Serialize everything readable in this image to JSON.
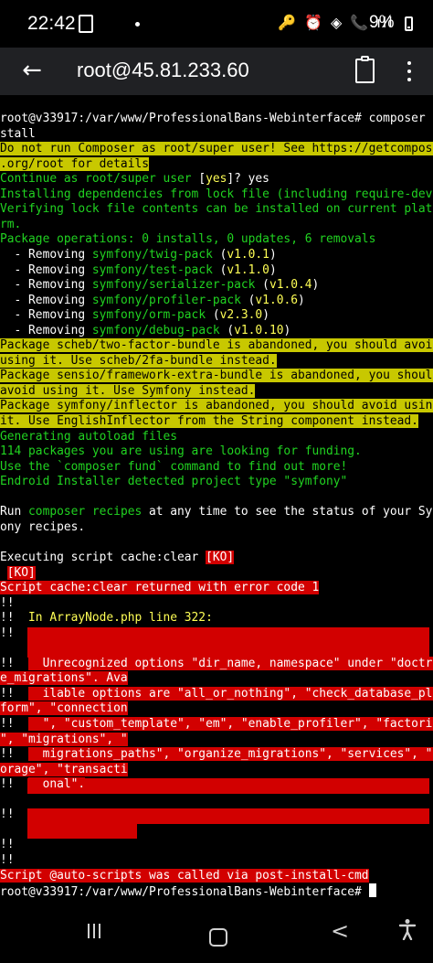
{
  "status_bar": {
    "time": "22:42",
    "dot": "•",
    "indicators": "🔑 ⏰ ◈ 📞.ıll",
    "battery": "9%"
  },
  "header": {
    "back_icon": "←",
    "title": "root@45.81.233.60",
    "clipboard_icon": "clipboard-icon",
    "menu_icon": "more-vert-icon"
  },
  "terminal": {
    "lines": [
      [
        {
          "t": "root@v33917:/var/www/ProfessionalBans-Webinterface# composer in",
          "c": "w"
        }
      ],
      [
        {
          "t": "stall",
          "c": "w"
        }
      ],
      [
        {
          "t": "Do not run Composer as root/super user! See https://getcomposer",
          "c": "hl"
        }
      ],
      [
        {
          "t": ".org/root for details",
          "c": "hl"
        }
      ],
      [
        {
          "t": "Continue as root/super user ",
          "c": "g"
        },
        {
          "t": "[",
          "c": "w"
        },
        {
          "t": "yes",
          "c": "y"
        },
        {
          "t": "]? yes",
          "c": "w"
        }
      ],
      [
        {
          "t": "Installing dependencies from lock file (including require-dev)",
          "c": "g"
        }
      ],
      [
        {
          "t": "Verifying lock file contents can be installed on current platfo",
          "c": "g"
        }
      ],
      [
        {
          "t": "rm.",
          "c": "g"
        }
      ],
      [
        {
          "t": "Package operations: 0 installs, 0 updates, 6 removals",
          "c": "g"
        }
      ],
      [
        {
          "t": "  - Removing ",
          "c": "w"
        },
        {
          "t": "symfony/twig-pack",
          "c": "g"
        },
        {
          "t": " (",
          "c": "w"
        },
        {
          "t": "v1.0.1",
          "c": "y"
        },
        {
          "t": ")",
          "c": "w"
        }
      ],
      [
        {
          "t": "  - Removing ",
          "c": "w"
        },
        {
          "t": "symfony/test-pack",
          "c": "g"
        },
        {
          "t": " (",
          "c": "w"
        },
        {
          "t": "v1.1.0",
          "c": "y"
        },
        {
          "t": ")",
          "c": "w"
        }
      ],
      [
        {
          "t": "  - Removing ",
          "c": "w"
        },
        {
          "t": "symfony/serializer-pack",
          "c": "g"
        },
        {
          "t": " (",
          "c": "w"
        },
        {
          "t": "v1.0.4",
          "c": "y"
        },
        {
          "t": ")",
          "c": "w"
        }
      ],
      [
        {
          "t": "  - Removing ",
          "c": "w"
        },
        {
          "t": "symfony/profiler-pack",
          "c": "g"
        },
        {
          "t": " (",
          "c": "w"
        },
        {
          "t": "v1.0.6",
          "c": "y"
        },
        {
          "t": ")",
          "c": "w"
        }
      ],
      [
        {
          "t": "  - Removing ",
          "c": "w"
        },
        {
          "t": "symfony/orm-pack",
          "c": "g"
        },
        {
          "t": " (",
          "c": "w"
        },
        {
          "t": "v2.3.0",
          "c": "y"
        },
        {
          "t": ")",
          "c": "w"
        }
      ],
      [
        {
          "t": "  - Removing ",
          "c": "w"
        },
        {
          "t": "symfony/debug-pack",
          "c": "g"
        },
        {
          "t": " (",
          "c": "w"
        },
        {
          "t": "v1.0.10",
          "c": "y"
        },
        {
          "t": ")",
          "c": "w"
        }
      ],
      [
        {
          "t": "Package scheb/two-factor-bundle is abandoned, you should avoid ",
          "c": "hl"
        }
      ],
      [
        {
          "t": "using it. Use scheb/2fa-bundle instead.",
          "c": "hl"
        }
      ],
      [
        {
          "t": "Package sensio/framework-extra-bundle is abandoned, you should ",
          "c": "hl"
        }
      ],
      [
        {
          "t": "avoid using it. Use Symfony instead.",
          "c": "hl"
        }
      ],
      [
        {
          "t": "Package symfony/inflector is abandoned, you should avoid using ",
          "c": "hl"
        }
      ],
      [
        {
          "t": "it. Use EnglishInflector from the String component instead.",
          "c": "hl"
        }
      ],
      [
        {
          "t": "Generating autoload files",
          "c": "g"
        }
      ],
      [
        {
          "t": "114 packages you are using are looking for funding.",
          "c": "g"
        }
      ],
      [
        {
          "t": "Use the `composer fund` command to find out more!",
          "c": "g"
        }
      ],
      [
        {
          "t": "Endroid Installer detected project type \"symfony\"",
          "c": "g"
        }
      ],
      [
        {
          "t": "",
          "c": "w"
        }
      ],
      [
        {
          "t": "Run ",
          "c": "w"
        },
        {
          "t": "composer recipes",
          "c": "g"
        },
        {
          "t": " at any time to see the status of your Symf",
          "c": "w"
        }
      ],
      [
        {
          "t": "ony recipes.",
          "c": "w"
        }
      ],
      [
        {
          "t": "",
          "c": "w"
        }
      ],
      [
        {
          "t": "Executing script cache:clear ",
          "c": "w"
        },
        {
          "t": "[KO]",
          "c": "red"
        }
      ],
      [
        {
          "t": " ",
          "c": "w"
        },
        {
          "t": "[KO]",
          "c": "red"
        }
      ],
      [
        {
          "t": "Script cache:clear returned with error code 1",
          "c": "red"
        }
      ],
      [
        {
          "t": "!!",
          "c": "w"
        }
      ],
      [
        {
          "t": "!!  ",
          "c": "w"
        },
        {
          "t": "In ArrayNode.php line 322:",
          "c": "y"
        }
      ],
      [
        {
          "t": "!!",
          "c": "w"
        }
      ],
      [
        {
          "t": "",
          "c": "w"
        }
      ],
      [
        {
          "t": "!!  ",
          "c": "w"
        },
        {
          "t": "  Unrecognized options \"dir_name, namespace\" under \"doctrin",
          "c": "red"
        }
      ],
      [
        {
          "t": "e_migrations\". Ava",
          "c": "red"
        }
      ],
      [
        {
          "t": "!!  ",
          "c": "w"
        },
        {
          "t": "  ilable options are \"all_or_nothing\", \"check_database_plat",
          "c": "red"
        }
      ],
      [
        {
          "t": "form\", \"connection",
          "c": "red"
        }
      ],
      [
        {
          "t": "!!  ",
          "c": "w"
        },
        {
          "t": "  \", \"custom_template\", \"em\", \"enable_profiler\", \"factories",
          "c": "red"
        }
      ],
      [
        {
          "t": "\", \"migrations\", \"",
          "c": "red"
        }
      ],
      [
        {
          "t": "!!  ",
          "c": "w"
        },
        {
          "t": "  migrations_paths\", \"organize_migrations\", \"services\", \"st",
          "c": "red"
        }
      ],
      [
        {
          "t": "orage\", \"transacti",
          "c": "red"
        }
      ],
      [
        {
          "t": "!!  ",
          "c": "w"
        },
        {
          "t": "  onal\".",
          "c": "red"
        }
      ],
      [
        {
          "t": "",
          "c": "w"
        }
      ],
      [
        {
          "t": "!!",
          "c": "w"
        }
      ],
      [
        {
          "t": "",
          "c": "w"
        }
      ],
      [
        {
          "t": "!!",
          "c": "w"
        }
      ],
      [
        {
          "t": "!!",
          "c": "w"
        }
      ],
      [
        {
          "t": "Script @auto-scripts was called via post-install-cmd",
          "c": "red"
        }
      ],
      [
        {
          "t": "root@v33917:/var/www/ProfessionalBans-Webinterface# ",
          "c": "w"
        }
      ]
    ]
  },
  "nav_bar": {
    "back_icon": "<",
    "accessibility_icon": "🯅"
  }
}
